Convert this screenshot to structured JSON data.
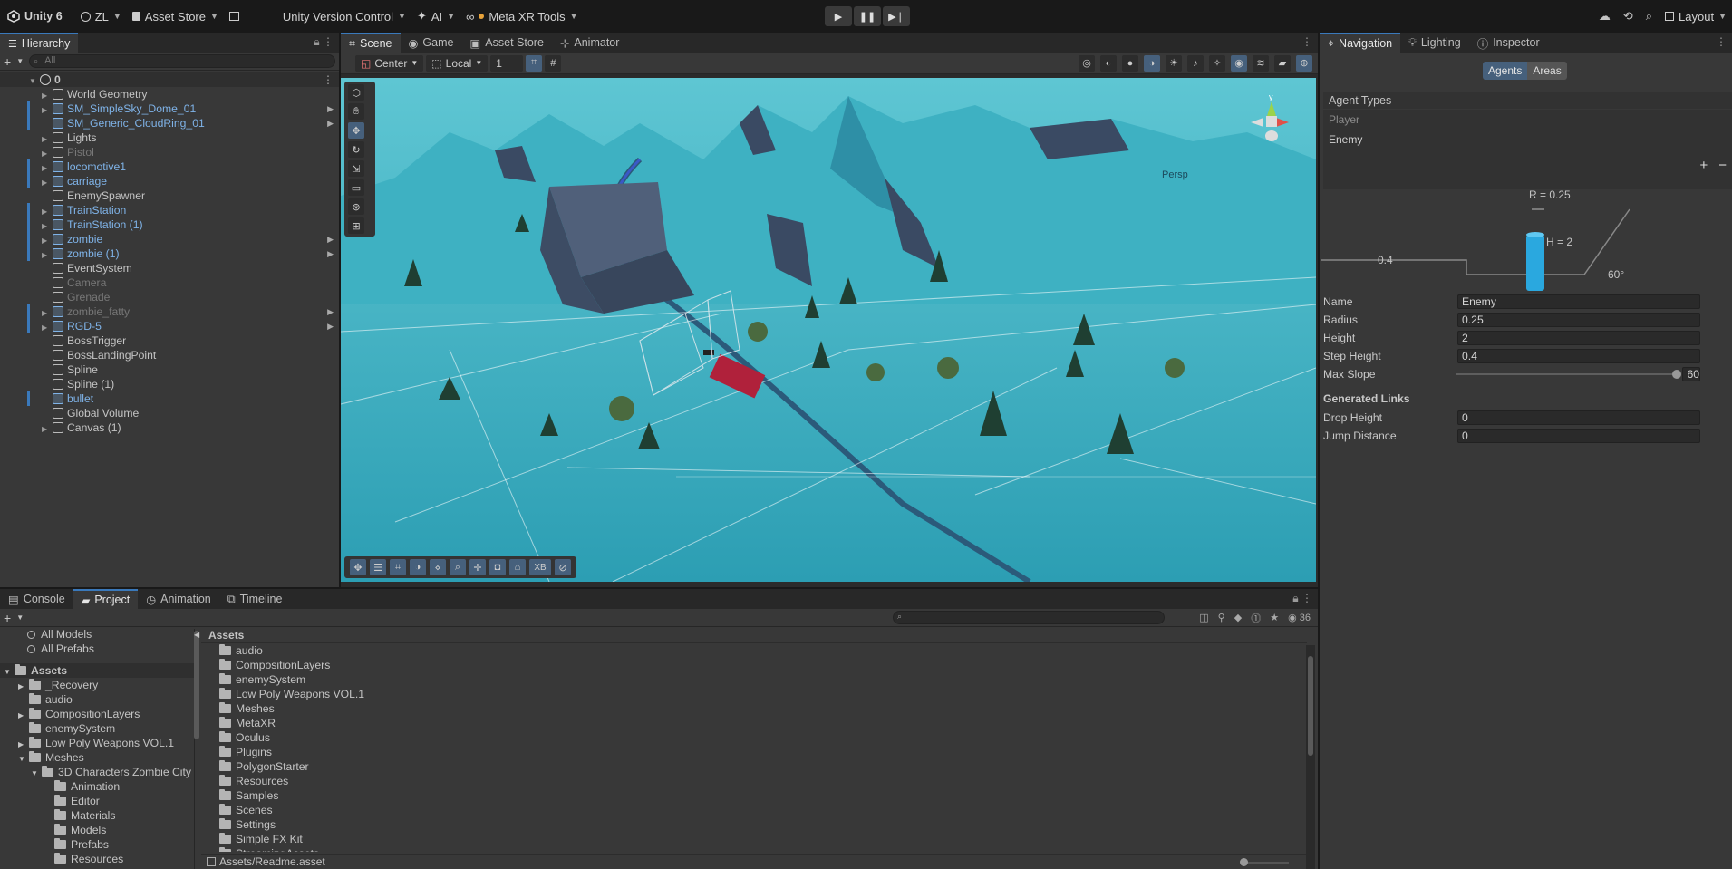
{
  "topbar": {
    "app_name": "Unity 6",
    "account": "ZL",
    "asset_store": "Asset Store",
    "version_control": "Unity Version Control",
    "ai": "AI",
    "meta_tools": "Meta XR Tools",
    "layout": "Layout"
  },
  "hierarchy": {
    "tab": "Hierarchy",
    "search_placeholder": "All",
    "scene_name": "0",
    "items": [
      {
        "label": "World Geometry"
      },
      {
        "label": "SM_SimpleSky_Dome_01"
      },
      {
        "label": "SM_Generic_CloudRing_01"
      },
      {
        "label": "Lights"
      },
      {
        "label": "Pistol"
      },
      {
        "label": "locomotive1"
      },
      {
        "label": "carriage"
      },
      {
        "label": "EnemySpawner"
      },
      {
        "label": "TrainStation"
      },
      {
        "label": "TrainStation (1)"
      },
      {
        "label": "zombie"
      },
      {
        "label": "zombie (1)"
      },
      {
        "label": "EventSystem"
      },
      {
        "label": "Camera"
      },
      {
        "label": "Grenade"
      },
      {
        "label": "zombie_fatty"
      },
      {
        "label": "RGD-5"
      },
      {
        "label": "BossTrigger"
      },
      {
        "label": "BossLandingPoint"
      },
      {
        "label": "Spline"
      },
      {
        "label": "Spline (1)"
      },
      {
        "label": "bullet"
      },
      {
        "label": "Global Volume"
      },
      {
        "label": "Canvas (1)"
      }
    ]
  },
  "scene": {
    "tabs": [
      "Scene",
      "Game",
      "Asset Store",
      "Animator"
    ],
    "pivot": "Center",
    "space": "Local",
    "snap": "1",
    "persp": "Persp",
    "axis_y": "y",
    "xb": "XB"
  },
  "navigation": {
    "tabs": [
      "Navigation",
      "Lighting",
      "Inspector"
    ],
    "agents_btn": "Agents",
    "areas_btn": "Areas",
    "agent_types": "Agent Types",
    "agent_list": [
      "Player",
      "Enemy"
    ],
    "diagram_r": "R = 0.25",
    "diagram_h": "H = 2",
    "diagram_step": "0.4",
    "diagram_slope": "60°",
    "fields": {
      "name_label": "Name",
      "name": "Enemy",
      "radius_label": "Radius",
      "radius": "0.25",
      "height_label": "Height",
      "height": "2",
      "step_label": "Step Height",
      "step": "0.4",
      "slope_label": "Max Slope",
      "slope": "60"
    },
    "generated_links": "Generated Links",
    "drop_label": "Drop Height",
    "drop": "0",
    "jump_label": "Jump Distance",
    "jump": "0"
  },
  "bottom": {
    "tabs": [
      "Console",
      "Project",
      "Animation",
      "Timeline"
    ],
    "count": "36",
    "favorites": [
      "All Models",
      "All Prefabs"
    ],
    "tree_root": "Assets",
    "tree": [
      {
        "label": "_Recovery"
      },
      {
        "label": "audio"
      },
      {
        "label": "CompositionLayers"
      },
      {
        "label": "enemySystem"
      },
      {
        "label": "Low Poly Weapons VOL.1"
      },
      {
        "label": "Meshes"
      },
      {
        "label": "3D Characters Zombie City"
      },
      {
        "label": "Animation"
      },
      {
        "label": "Editor"
      },
      {
        "label": "Materials"
      },
      {
        "label": "Models"
      },
      {
        "label": "Prefabs"
      },
      {
        "label": "Resources"
      }
    ],
    "breadcrumb": "Assets",
    "folders": [
      "audio",
      "CompositionLayers",
      "enemySystem",
      "Low Poly Weapons VOL.1",
      "Meshes",
      "MetaXR",
      "Oculus",
      "Plugins",
      "PolygonStarter",
      "Resources",
      "Samples",
      "Scenes",
      "Settings",
      "Simple FX Kit",
      "StreamingAssets"
    ],
    "selected_file": "Assets/Readme.asset"
  }
}
